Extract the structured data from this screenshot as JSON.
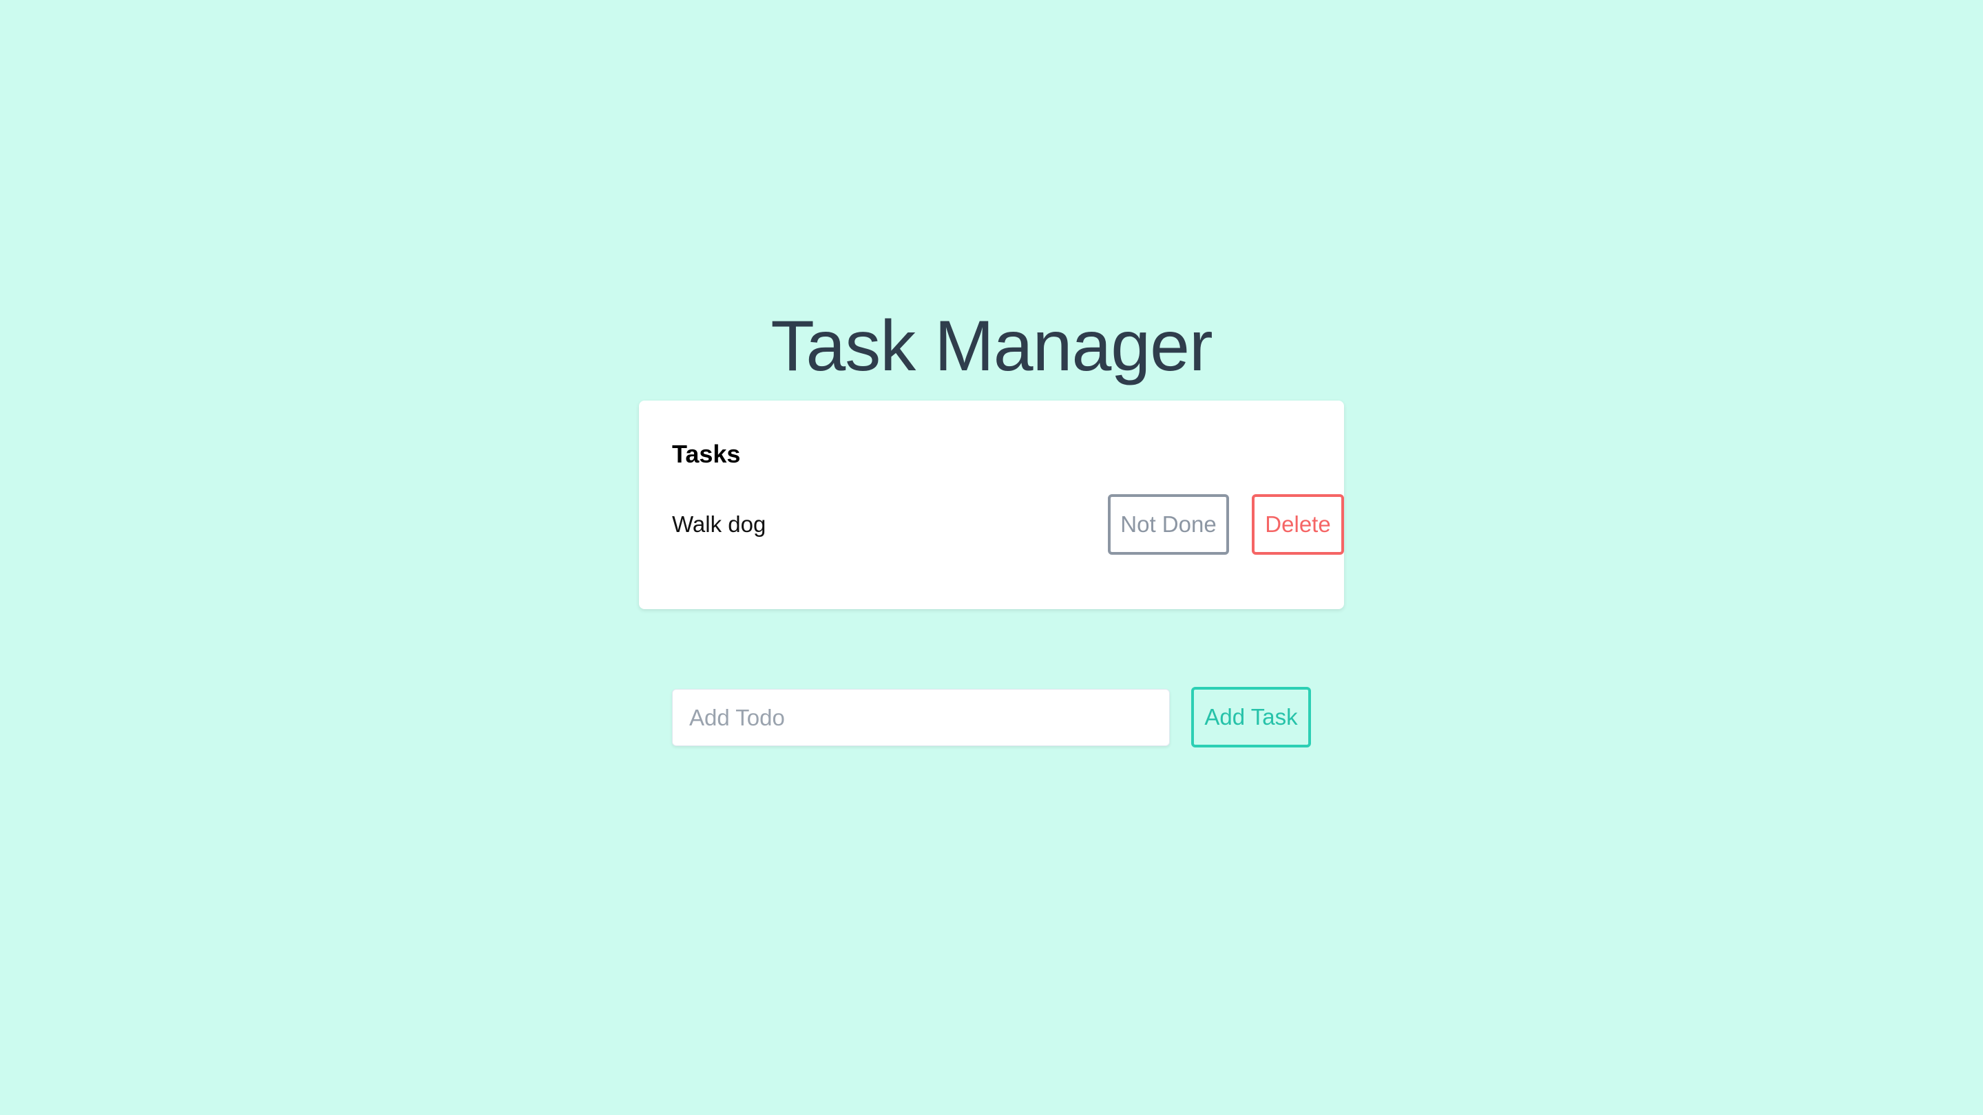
{
  "page": {
    "title": "Task Manager",
    "background_color": "#ccfbef"
  },
  "tasks_card": {
    "heading": "Tasks",
    "items": [
      {
        "text": "Walk dog",
        "status_button_label": "Not Done",
        "delete_button_label": "Delete"
      }
    ]
  },
  "add_form": {
    "input_placeholder": "Add Todo",
    "input_value": "",
    "add_button_label": "Add Task"
  },
  "colors": {
    "title_text": "#2f3d4c",
    "not_done_button": "#8c96a3",
    "delete_button": "#f56565",
    "add_button": "#26c2a9"
  }
}
